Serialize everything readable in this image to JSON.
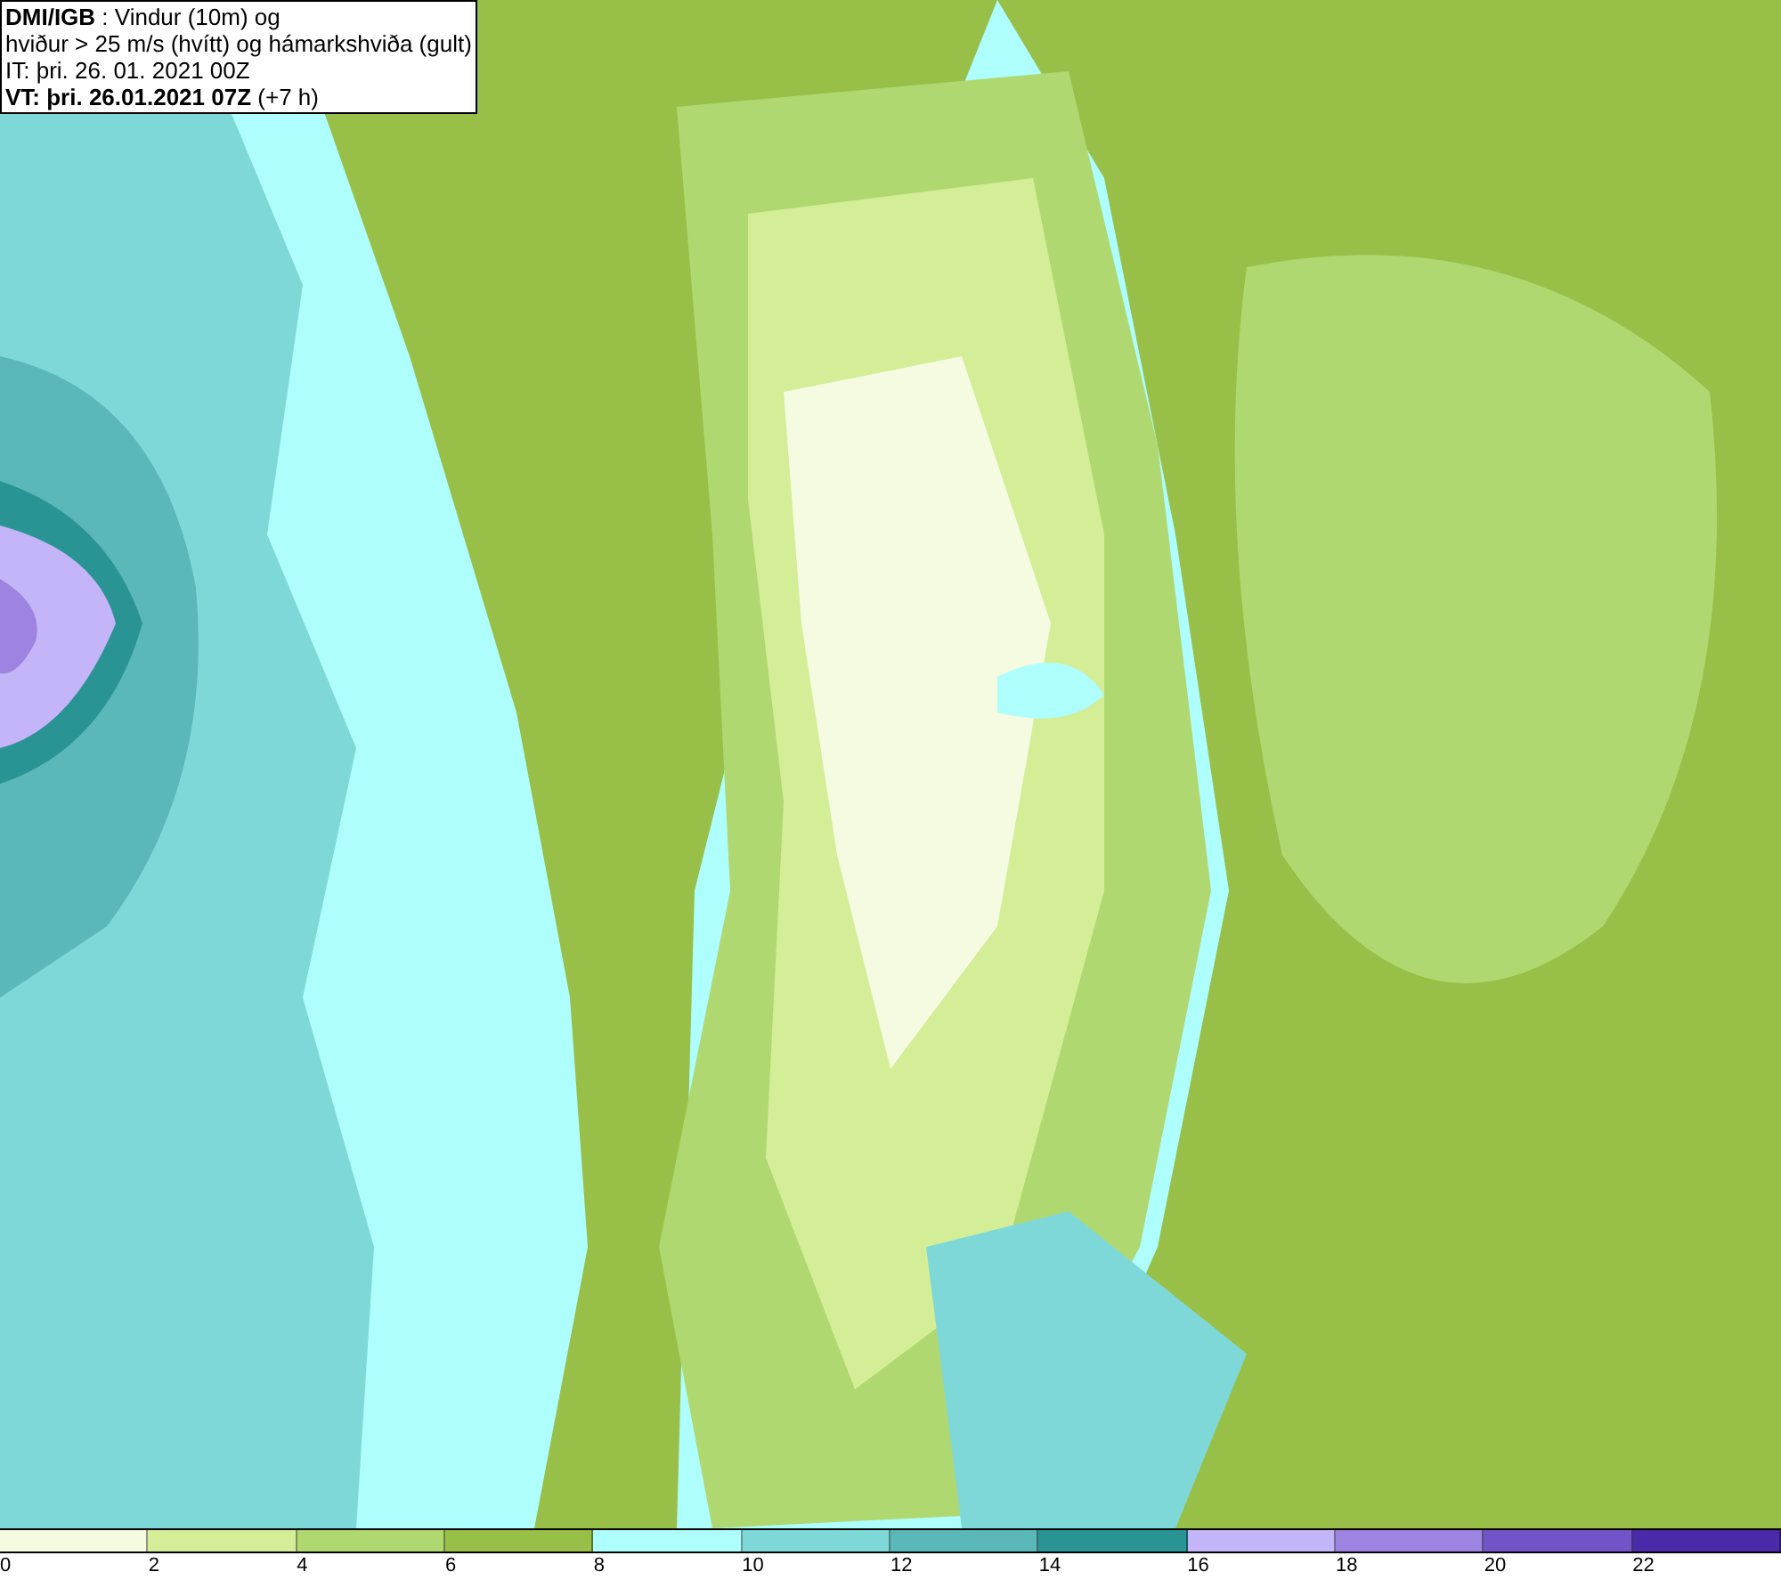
{
  "info_box": {
    "lines": [
      "**DMI/IGB** : Vindur (10m) og",
      "hviður > 25 m/s (hvítt) og hámarkshviða (gult)",
      "IT: þri. 26. 01. 2021 00Z",
      "**VT: þri. 26.01.2021 07Z** (+7 h)"
    ]
  },
  "legend": {
    "segments": [
      {
        "color": "#f5fbe0"
      },
      {
        "color": "#d4ee98"
      },
      {
        "color": "#b0d870"
      },
      {
        "color": "#98c048"
      },
      {
        "color": "#aefefe"
      },
      {
        "color": "#7fd8d8"
      },
      {
        "color": "#5ab8b8"
      },
      {
        "color": "#2a9494"
      },
      {
        "color": "#c4b4f8"
      },
      {
        "color": "#9c84e0"
      },
      {
        "color": "#7054c8"
      },
      {
        "color": "#4a2aa8"
      }
    ],
    "ticks": [
      "0",
      "2",
      "4",
      "6",
      "8",
      "10",
      "12",
      "14",
      "16",
      "18",
      "20",
      "22"
    ]
  }
}
